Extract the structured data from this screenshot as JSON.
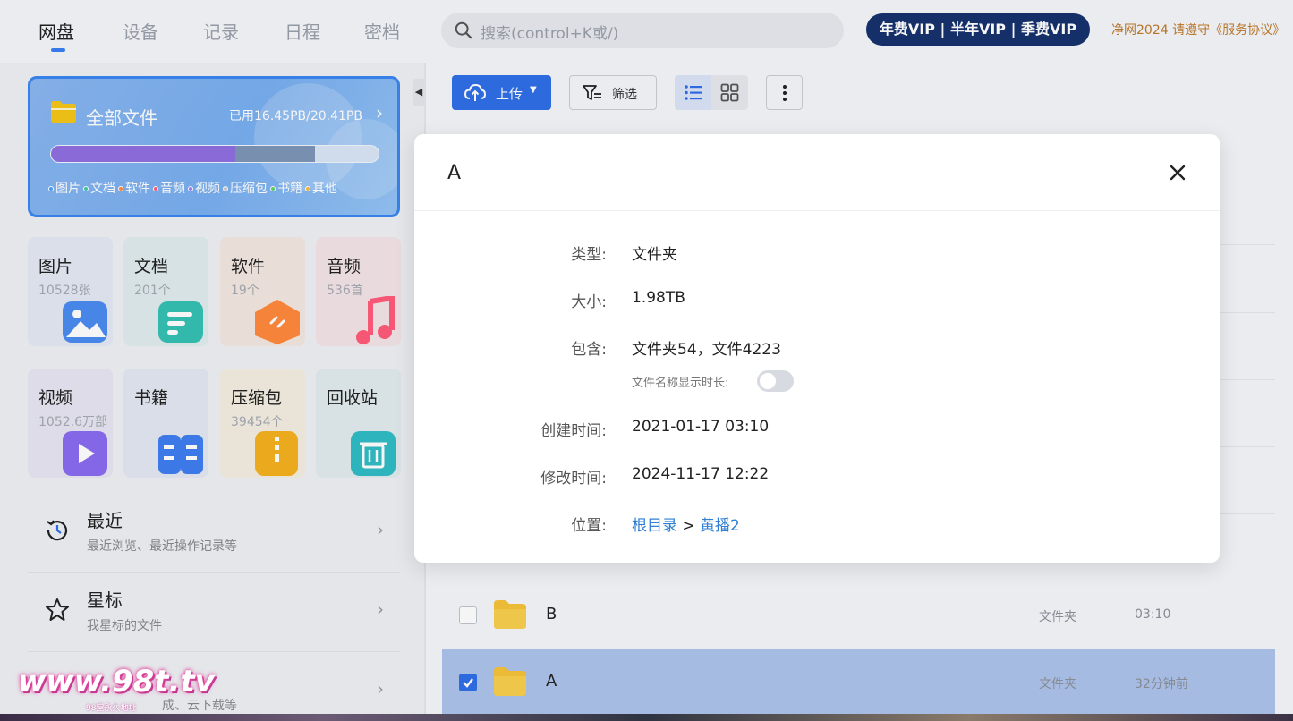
{
  "nav": {
    "tabs": [
      "网盘",
      "设备",
      "记录",
      "日程",
      "密档"
    ],
    "active": 0
  },
  "search": {
    "placeholder": "搜索(control+K或/)"
  },
  "vip": {
    "label": "年费VIP | 半年VIP | 季费VIP"
  },
  "notice": "净网2024 请遵守《服务协议》",
  "storage": {
    "title": "全部文件",
    "used_label": "已用16.45PB/20.41PB",
    "used_fraction": 0.806,
    "legend": [
      {
        "label": "图片",
        "color": "#4aa3ff"
      },
      {
        "label": "文档",
        "color": "#43c6ac"
      },
      {
        "label": "软件",
        "color": "#ff8a3d"
      },
      {
        "label": "音频",
        "color": "#ff5b7a"
      },
      {
        "label": "视频",
        "color": "#a378ff"
      },
      {
        "label": "压缩包",
        "color": "#c9c9c9"
      },
      {
        "label": "书籍",
        "color": "#5ed16a"
      },
      {
        "label": "其他",
        "color": "#f5b942"
      }
    ]
  },
  "categories": [
    {
      "name": "图片",
      "count": "10528张",
      "icon": "image-icon",
      "color": "#4a8cf0"
    },
    {
      "name": "文档",
      "count": "201个",
      "icon": "document-icon",
      "color": "#35c1b3"
    },
    {
      "name": "软件",
      "count": "19个",
      "icon": "software-icon",
      "color": "#ff8a3d"
    },
    {
      "name": "音频",
      "count": "536首",
      "icon": "music-icon",
      "color": "#ff5b7a"
    },
    {
      "name": "视频",
      "count": "1052.6万部",
      "icon": "video-icon",
      "color": "#8a6cf0"
    },
    {
      "name": "书籍",
      "count": "",
      "icon": "book-icon",
      "color": "#3f7ef0"
    },
    {
      "name": "压缩包",
      "count": "39454个",
      "icon": "archive-icon",
      "color": "#f5b020"
    },
    {
      "name": "回收站",
      "count": "",
      "icon": "trash-icon",
      "color": "#2fbcc4"
    }
  ],
  "menu": [
    {
      "title": "最近",
      "subtitle": "最近浏览、最近操作记录等",
      "icon": "history-icon"
    },
    {
      "title": "星标",
      "subtitle": "我星标的文件",
      "icon": "star-icon"
    },
    {
      "title": "",
      "subtitle": "成、云下载等",
      "icon": "download-icon"
    }
  ],
  "toolbar": {
    "upload_label": "上传",
    "filter_label": "筛选"
  },
  "files": [
    {
      "name": "B",
      "type": "文件夹",
      "time": "03:10",
      "selected": false
    },
    {
      "name": "A",
      "type": "文件夹",
      "time": "32分钟前",
      "selected": true
    }
  ],
  "modal": {
    "title": "A",
    "fields": {
      "type_label": "类型:",
      "type_value": "文件夹",
      "size_label": "大小:",
      "size_value": "1.98TB",
      "contains_label": "包含:",
      "contains_value": "文件夹54，文件4223",
      "duration_label": "文件名称显示时长:",
      "duration_enabled": false,
      "created_label": "创建时间:",
      "created_value": "2021-01-17 03:10",
      "modified_label": "修改时间:",
      "modified_value": "2024-11-17 12:22",
      "location_label": "位置:",
      "location_root": "根目录",
      "location_sep": ">",
      "location_folder": "黄播2"
    }
  },
  "watermark": {
    "text": "www.98t.tv",
    "sub": "98堂永久地址"
  }
}
